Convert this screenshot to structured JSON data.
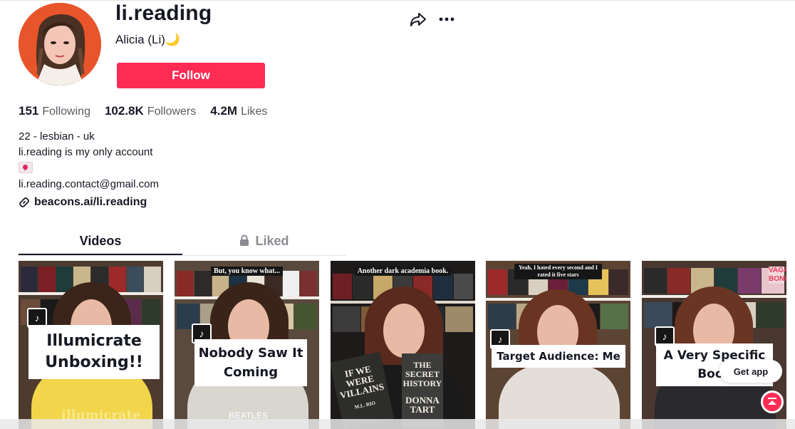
{
  "profile": {
    "username": "li.reading",
    "display_name": "Alicia (Li)🌙",
    "follow_label": "Follow"
  },
  "stats": [
    {
      "value": "151",
      "label": "Following"
    },
    {
      "value": "102.8K",
      "label": "Followers"
    },
    {
      "value": "4.2M",
      "label": "Likes"
    }
  ],
  "bio": {
    "line1": "22 - lesbian - uk",
    "line2": "li.reading is my only account",
    "line3_icon": "love-letter-emoji-icon",
    "line4": "li.reading.contact@gmail.com",
    "link": "beacons.ai/li.reading"
  },
  "tabs": {
    "videos": "Videos",
    "liked": "Liked"
  },
  "videos": [
    {
      "caption": "Illumicrate Unboxing!!",
      "overlay_text": "",
      "bottom_text": "illumicrate"
    },
    {
      "caption": "Nobody Saw It Coming",
      "overlay_text": "But, you know what...",
      "bottom_text": "BEATLES"
    },
    {
      "caption": "",
      "overlay_text": "Another dark academia book.",
      "book1": "IF WE WERE VILLAINS",
      "book1_author": "M.L. RIO",
      "book2": "THE SECRET HISTORY",
      "book2_author": "DONNA TART"
    },
    {
      "caption": "Target Audience: Me",
      "overlay_text": "Yeah, I hated every second and I rated it five stars"
    },
    {
      "caption": "A Very Specific Book",
      "overlay_text": "",
      "spine_text": "VAGA BOND"
    }
  ],
  "floating": {
    "get_app": "Get app"
  },
  "colors": {
    "follow_red": "#fe2c55",
    "text": "#161823",
    "secondary": "#8a8b91"
  }
}
